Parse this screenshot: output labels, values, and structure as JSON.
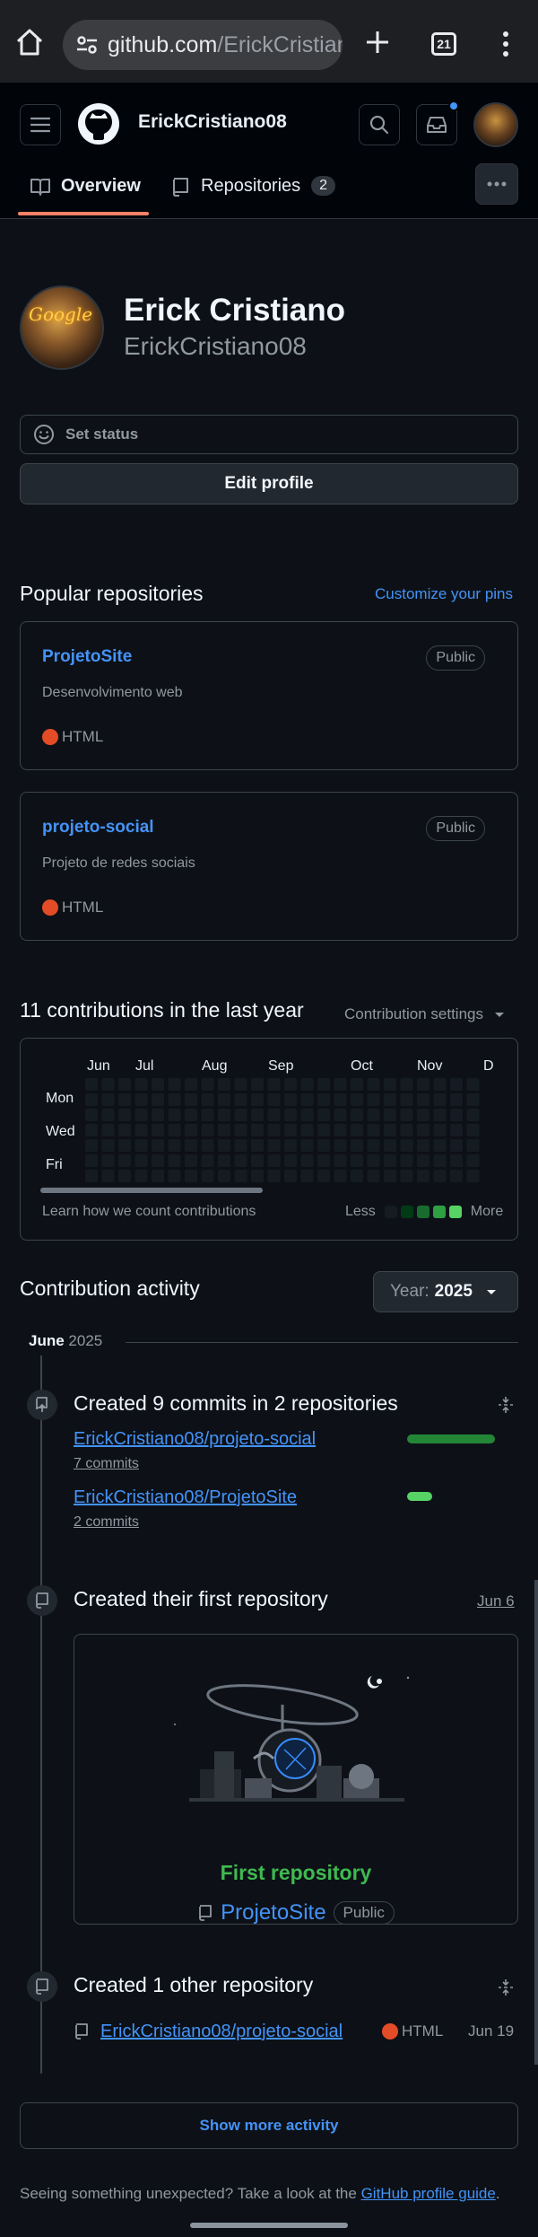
{
  "browser": {
    "url_domain": "github.com",
    "url_path": "/ErickCristian",
    "tab_count": "21"
  },
  "header": {
    "username": "ErickCristiano08",
    "tabs": [
      {
        "label": "Overview"
      },
      {
        "label": "Repositories",
        "count": "2"
      }
    ]
  },
  "profile": {
    "avatar_text": "Google",
    "display_name": "Erick Cristiano",
    "login": "ErickCristiano08",
    "set_status_label": "Set status",
    "edit_profile_label": "Edit profile"
  },
  "popular": {
    "title": "Popular repositories",
    "customize_label": "Customize your pins",
    "repos": [
      {
        "name": "ProjetoSite",
        "visibility": "Public",
        "description": "Desenvolvimento web",
        "language": "HTML"
      },
      {
        "name": "projeto-social",
        "visibility": "Public",
        "description": "Projeto de redes sociais",
        "language": "HTML"
      }
    ]
  },
  "contributions": {
    "title": "11 contributions in the last year",
    "settings_label": "Contribution settings",
    "months": [
      "Jun",
      "Jul",
      "Aug",
      "Sep",
      "Oct",
      "Nov",
      "D"
    ],
    "days": [
      "Mon",
      "Wed",
      "Fri"
    ],
    "learn_label": "Learn how we count contributions",
    "legend_less": "Less",
    "legend_more": "More",
    "legend_colors": [
      "#151b23",
      "#033a16",
      "#196c2e",
      "#2ea043",
      "#56d364"
    ]
  },
  "activity": {
    "title": "Contribution activity",
    "year_label": "Year:",
    "year_value": "2025",
    "month": "June",
    "month_year": "2025",
    "commits": {
      "title": "Created 9 commits in 2 repositories",
      "repos": [
        {
          "name": "ErickCristiano08/projeto-social",
          "commits": "7 commits",
          "share": 0.78
        },
        {
          "name": "ErickCristiano08/ProjetoSite",
          "commits": "2 commits",
          "share": 0.22
        }
      ]
    },
    "first_repo": {
      "title": "Created their first repository",
      "date": "Jun 6",
      "card_title": "First repository",
      "repo_name": "ProjetoSite",
      "visibility": "Public"
    },
    "other_repo": {
      "title": "Created 1 other repository",
      "name": "ErickCristiano08/projeto-social",
      "language": "HTML",
      "date": "Jun 19"
    },
    "show_more_label": "Show more activity"
  },
  "footer": {
    "text": "Seeing something unexpected? Take a look at the",
    "link": "GitHub profile guide",
    "end": "."
  },
  "colors": {
    "bg": "#0d1117",
    "link": "#4493f8",
    "html_lang": "#e34c26",
    "green": "#3fb950",
    "underline_active": "#f78166"
  }
}
